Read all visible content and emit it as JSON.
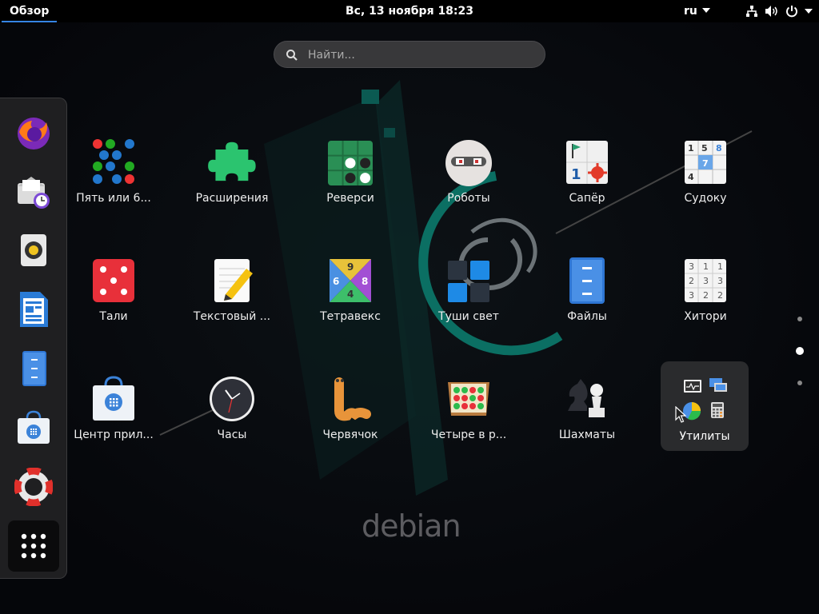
{
  "topbar": {
    "activities": "Обзор",
    "clock": "Вс, 13 ноября  18:23",
    "language": "ru",
    "icons": [
      "network-icon",
      "volume-icon",
      "power-icon"
    ]
  },
  "search": {
    "placeholder": "Найти..."
  },
  "dash": {
    "items": [
      "firefox",
      "evolution-mail",
      "rhythmbox",
      "libreoffice-writer",
      "files",
      "software",
      "help",
      "show-applications"
    ]
  },
  "apps": [
    {
      "label": "Пять или 6...",
      "icon": "five-or-more-icon"
    },
    {
      "label": "Расширения",
      "icon": "extensions-icon"
    },
    {
      "label": "Реверси",
      "icon": "reversi-icon"
    },
    {
      "label": "Роботы",
      "icon": "robots-icon"
    },
    {
      "label": "Сапёр",
      "icon": "mines-icon"
    },
    {
      "label": "Судоку",
      "icon": "sudoku-icon"
    },
    {
      "label": "Тали",
      "icon": "tali-icon"
    },
    {
      "label": "Текстовый ...",
      "icon": "text-editor-icon"
    },
    {
      "label": "Тетравекс",
      "icon": "tetravex-icon"
    },
    {
      "label": "Туши свет",
      "icon": "lightsoff-icon"
    },
    {
      "label": "Файлы",
      "icon": "files-icon"
    },
    {
      "label": "Хитори",
      "icon": "hitori-icon"
    },
    {
      "label": "Центр прил...",
      "icon": "software-icon"
    },
    {
      "label": "Часы",
      "icon": "clocks-icon"
    },
    {
      "label": "Червячок",
      "icon": "nibbles-icon"
    },
    {
      "label": "Четыре в р...",
      "icon": "four-in-a-row-icon"
    },
    {
      "label": "Шахматы",
      "icon": "chess-icon"
    }
  ],
  "folder": {
    "label": "Утилиты"
  },
  "pagination": {
    "pages": 3,
    "current": 2
  },
  "wallpaper": {
    "brand": "debian"
  },
  "colors": {
    "accent": "#3584e4",
    "debian_teal": "#0b6f63"
  }
}
